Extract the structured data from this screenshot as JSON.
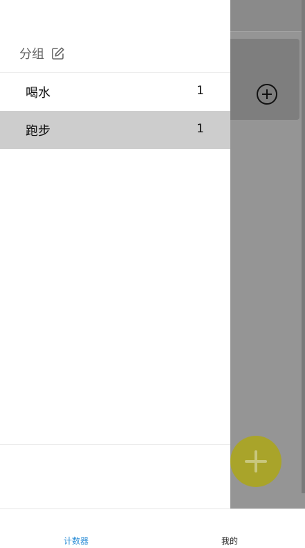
{
  "drawer": {
    "section_title": "分组",
    "groups": [
      {
        "name": "喝水",
        "count": "1",
        "selected": false
      },
      {
        "name": "跑步",
        "count": "1",
        "selected": true
      }
    ]
  },
  "icons": {
    "edit": "edit-icon",
    "add_counter": "add-circle-icon",
    "fab": "plus-icon"
  },
  "colors": {
    "accent_blue": "#2f8fd7",
    "fab_yellow": "#a9a42a",
    "selected_row": "#cdcdcd",
    "scrim": "#959595"
  },
  "bottom_nav": {
    "items": [
      {
        "label": "计数器",
        "active": true
      },
      {
        "label": "我的",
        "active": false
      }
    ]
  }
}
